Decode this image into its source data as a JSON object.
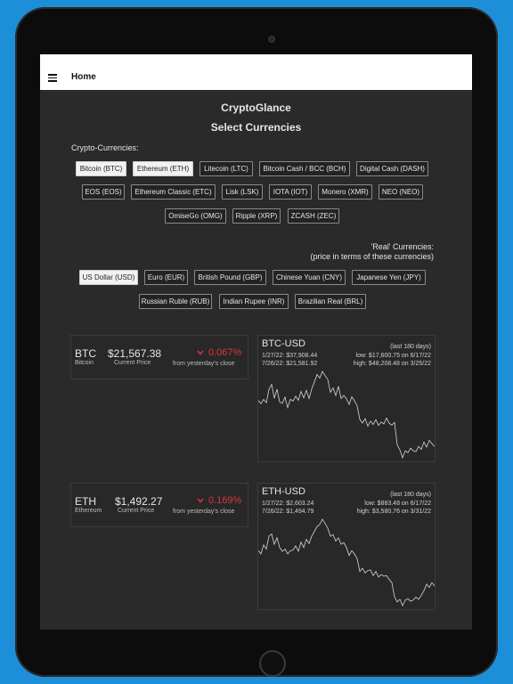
{
  "appbar": {
    "title": "Home",
    "menu_icon": "hamburger-menu-icon"
  },
  "app_name": "CryptoGlance",
  "select_title": "Select Currencies",
  "crypto_section": {
    "label": "Crypto-Currencies:",
    "options": [
      {
        "label": "Bitcoin (BTC)",
        "selected": true
      },
      {
        "label": "Ethereum (ETH)",
        "selected": true
      },
      {
        "label": "Litecoin (LTC)",
        "selected": false
      },
      {
        "label": "Bitcoin Cash / BCC (BCH)",
        "selected": false
      },
      {
        "label": "Digital Cash (DASH)",
        "selected": false
      },
      {
        "label": "EOS (EOS)",
        "selected": false
      },
      {
        "label": "Ethereum Classic (ETC)",
        "selected": false
      },
      {
        "label": "Lisk (LSK)",
        "selected": false
      },
      {
        "label": "IOTA (IOT)",
        "selected": false
      },
      {
        "label": "Monero (XMR)",
        "selected": false
      },
      {
        "label": "NEO (NEO)",
        "selected": false
      },
      {
        "label": "OmiseGo (OMG)",
        "selected": false
      },
      {
        "label": "Ripple (XRP)",
        "selected": false
      },
      {
        "label": "ZCASH (ZEC)",
        "selected": false
      }
    ]
  },
  "fiat_section": {
    "label": "'Real' Currencies:",
    "sublabel": "(price in terms of these currencies)",
    "options": [
      {
        "label": "US Dollar (USD)",
        "selected": true
      },
      {
        "label": "Euro (EUR)",
        "selected": false
      },
      {
        "label": "British Pound (GBP)",
        "selected": false
      },
      {
        "label": "Chinese Yuan (CNY)",
        "selected": false
      },
      {
        "label": "Japanese Yen (JPY)",
        "selected": false
      },
      {
        "label": "Russian Ruble (RUB)",
        "selected": false
      },
      {
        "label": "Indian Rupee (INR)",
        "selected": false
      },
      {
        "label": "Brazilian Real (BRL)",
        "selected": false
      }
    ]
  },
  "colors": {
    "negative": "#e0343b",
    "line": "#d8d8d8",
    "screen_bg": "#2a2a2b"
  },
  "tickers": [
    {
      "symbol": "BTC",
      "name": "Bitcoin",
      "price": "$21,567.38",
      "price_label": "Current Price",
      "change": "0.067%",
      "change_label": "from yesterday's close",
      "chart": {
        "pair": "BTC-USD",
        "period": "(last 180 days)",
        "start": "1/27/22: $37,908.44",
        "end": "7/26/22: $21,581.92",
        "low": "low: $17,600.75 on 6/17/22",
        "high": "high: $48,208.48 on 3/25/22",
        "min": 17600.75,
        "max": 48208.48,
        "values": [
          37908,
          36800,
          38300,
          37100,
          41800,
          43600,
          38700,
          41900,
          37400,
          36900,
          39100,
          35400,
          38300,
          37700,
          39400,
          38000,
          41100,
          38800,
          41500,
          38600,
          42000,
          44500,
          47100,
          45800,
          48208,
          46700,
          45400,
          40800,
          42300,
          39700,
          42900,
          38600,
          39700,
          38500,
          36500,
          39200,
          37800,
          36000,
          31200,
          29900,
          31500,
          28800,
          30600,
          29400,
          31100,
          29100,
          30300,
          29600,
          31700,
          29800,
          29200,
          30100,
          22200,
          20400,
          17600,
          20100,
          19400,
          21000,
          20100,
          19800,
          21600,
          20600,
          23200,
          21400,
          23800,
          22600,
          21581
        ]
      }
    },
    {
      "symbol": "ETH",
      "name": "Ethereum",
      "price": "$1,492.27",
      "price_label": "Current Price",
      "change": "0.169%",
      "change_label": "from yesterday's close",
      "chart": {
        "pair": "ETH-USD",
        "period": "(last 180 days)",
        "start": "1/27/22: $2,603.24",
        "end": "7/26/22: $1,494.79",
        "low": "low: $883.48 on 6/17/22",
        "high": "high: $3,580.76 on 3/31/22",
        "min": 883.48,
        "max": 3580.76,
        "values": [
          2603,
          2500,
          2780,
          2650,
          3050,
          3120,
          2800,
          3000,
          2700,
          2580,
          2650,
          2500,
          2600,
          2620,
          2750,
          2580,
          2870,
          2700,
          2950,
          2820,
          3050,
          3200,
          3350,
          3420,
          3580,
          3450,
          3300,
          3050,
          3100,
          2900,
          3000,
          2800,
          2850,
          2700,
          2450,
          2600,
          2500,
          2350,
          1950,
          2050,
          1900,
          1980,
          2000,
          1820,
          1950,
          1780,
          1850,
          1800,
          1820,
          1700,
          1600,
          1150,
          1000,
          1080,
          883,
          1050,
          1100,
          1020,
          1060,
          1150,
          1080,
          1200,
          1350,
          1550,
          1450,
          1600,
          1494
        ]
      }
    }
  ]
}
